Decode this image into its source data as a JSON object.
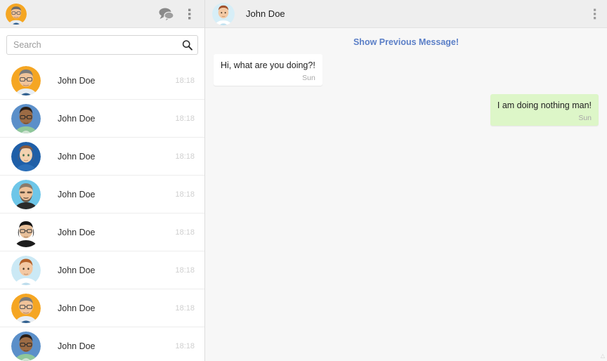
{
  "sidebar": {
    "header": {
      "profile_avatar_name": "current-user-avatar",
      "chats_icon": "chats-icon",
      "menu_icon": "more-vertical-icon"
    },
    "search": {
      "placeholder": "Search",
      "value": "",
      "icon": "search-icon"
    },
    "chats": [
      {
        "name": "John Doe",
        "time": "18:18",
        "avatar": "avatar-orange-glasses"
      },
      {
        "name": "John Doe",
        "time": "18:18",
        "avatar": "avatar-blue-darkskin"
      },
      {
        "name": "John Doe",
        "time": "18:18",
        "avatar": "avatar-navy-longhair"
      },
      {
        "name": "John Doe",
        "time": "18:18",
        "avatar": "avatar-cyan-beard"
      },
      {
        "name": "John Doe",
        "time": "18:18",
        "avatar": "avatar-white-blackhair"
      },
      {
        "name": "John Doe",
        "time": "18:18",
        "avatar": "avatar-lightblue-ginger"
      },
      {
        "name": "John Doe",
        "time": "18:18",
        "avatar": "avatar-orange-glasses"
      },
      {
        "name": "John Doe",
        "time": "18:18",
        "avatar": "avatar-blue-darkskin"
      }
    ]
  },
  "conversation": {
    "header": {
      "title": "John Doe",
      "avatar_name": "contact-avatar",
      "menu_icon": "more-vertical-icon"
    },
    "show_previous_label": "Show Previous Message!",
    "messages": [
      {
        "text": "Hi, what are you doing?!",
        "time": "Sun",
        "direction": "in"
      },
      {
        "text": "I am doing nothing man!",
        "time": "Sun",
        "direction": "out"
      }
    ]
  },
  "colors": {
    "header_bg": "#eeeeee",
    "chat_bg": "#f7f7f7",
    "outgoing_bubble": "#ddf6c8",
    "incoming_bubble": "#ffffff",
    "link_blue": "#5b7fc7",
    "time_gray": "#cfcfcf"
  }
}
